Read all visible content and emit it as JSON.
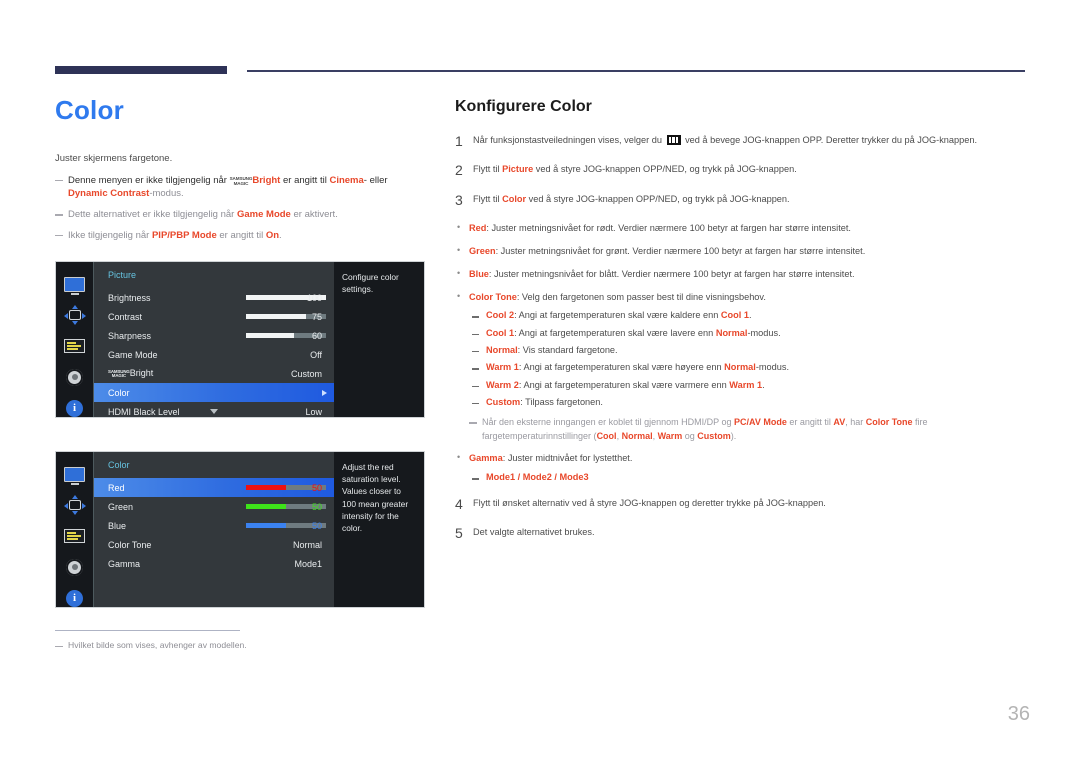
{
  "page": {
    "number": "36"
  },
  "left": {
    "title": "Color",
    "intro": "Juster skjermens fargetone.",
    "notes": [
      {
        "pre": "Denne menyen er ikke tilgjengelig når ",
        "magic_top": "SAMSUNG",
        "magic_bottom": "MAGIC",
        "magic_word": "Bright",
        "mid": " er angitt til ",
        "b1": "Cinema",
        "mid2": "- eller ",
        "b2": "Dynamic Contrast",
        "post": "-modus."
      },
      {
        "pre": "Dette alternativet er ikke tilgjengelig når ",
        "b1": "Game Mode",
        "post": " er aktivert."
      },
      {
        "pre": "Ikke tilgjengelig når ",
        "b1": "PIP/PBP Mode",
        "mid": " er angitt til ",
        "b2": "On",
        "post": "."
      }
    ],
    "footnote": "Hvilket bilde som vises, avhenger av modellen."
  },
  "osd1": {
    "title": "Picture",
    "description": "Configure color settings.",
    "rows": [
      {
        "label": "Brightness",
        "value": "100",
        "slider": 100,
        "type": "slider"
      },
      {
        "label": "Contrast",
        "value": "75",
        "slider": 75,
        "type": "slider"
      },
      {
        "label": "Sharpness",
        "value": "60",
        "slider": 60,
        "type": "slider"
      },
      {
        "label": "Game Mode",
        "value": "Off",
        "type": "value"
      },
      {
        "label": "Bright",
        "magic_top": "SAMSUNG",
        "magic_bottom": "MAGIC",
        "value": "Custom",
        "type": "magic"
      },
      {
        "label": "Color",
        "value": "",
        "type": "selected"
      },
      {
        "label": "HDMI Black Level",
        "value": "Low",
        "type": "value"
      }
    ],
    "icons": [
      "monitor-icon",
      "pip-icon",
      "osd-icon",
      "gear-icon",
      "info-icon"
    ]
  },
  "osd2": {
    "title": "Color",
    "description": "Adjust the red saturation level. Values closer to 100 mean greater intensity for the color.",
    "rows": [
      {
        "label": "Red",
        "value": "50",
        "slider": 50,
        "type": "slider-selected",
        "color": "#ee1111"
      },
      {
        "label": "Green",
        "value": "50",
        "slider": 50,
        "type": "slider",
        "color": "#3ee31a"
      },
      {
        "label": "Blue",
        "value": "50",
        "slider": 50,
        "type": "slider",
        "color": "#3b82f0"
      },
      {
        "label": "Color Tone",
        "value": "Normal",
        "type": "value"
      },
      {
        "label": "Gamma",
        "value": "Mode1",
        "type": "value"
      }
    ],
    "icons": [
      "monitor-icon",
      "pip-icon",
      "osd-icon",
      "gear-icon",
      "info-icon"
    ]
  },
  "right": {
    "title": "Konfigurere Color",
    "step1": {
      "num": "1",
      "pre": "Når funksjonstastveiledningen vises, velger du ",
      "post": " ved å bevege JOG-knappen OPP. Deretter trykker du på JOG-knappen."
    },
    "step2": {
      "num": "2",
      "pre": "Flytt til ",
      "bold": "Picture",
      "post": " ved å styre JOG-knappen OPP/NED, og trykk på JOG-knappen."
    },
    "step3": {
      "num": "3",
      "pre": "Flytt til ",
      "bold": "Color",
      "post": " ved å styre JOG-knappen OPP/NED, og trykk på JOG-knappen."
    },
    "step4": {
      "num": "4",
      "text": "Flytt til ønsket alternativ ved å styre JOG-knappen og deretter trykke på JOG-knappen."
    },
    "step5": {
      "num": "5",
      "text": "Det valgte alternativet brukes."
    },
    "bullets": {
      "red": {
        "bold": "Red",
        "text": ": Juster metningsnivået for rødt. Verdier nærmere 100 betyr at fargen har større intensitet."
      },
      "green": {
        "bold": "Green",
        "text": ": Juster metningsnivået for grønt. Verdier nærmere 100 betyr at fargen har større intensitet."
      },
      "blue": {
        "bold": "Blue",
        "text": ": Juster metningsnivået for blått. Verdier nærmere 100 betyr at fargen har større intensitet."
      },
      "colortone": {
        "bold": "Color Tone",
        "text": ": Velg den fargetonen som passer best til dine visningsbehov."
      },
      "gamma": {
        "bold": "Gamma",
        "text": ": Juster midtnivået for lystetthet."
      }
    },
    "tone_subs": [
      {
        "bold": "Cool 2",
        "pre": ": Angi at fargetemperaturen skal være kaldere enn ",
        "bold2": "Cool 1",
        "post": "."
      },
      {
        "bold": "Cool 1",
        "pre": ": Angi at fargetemperaturen skal være lavere enn ",
        "bold2": "Normal",
        "post": "-modus."
      },
      {
        "bold": "Normal",
        "pre": ": Vis standard fargetone.",
        "bold2": "",
        "post": ""
      },
      {
        "bold": "Warm 1",
        "pre": ": Angi at fargetemperaturen skal være høyere enn ",
        "bold2": "Normal",
        "post": "-modus."
      },
      {
        "bold": "Warm 2",
        "pre": ": Angi at fargetemperaturen skal være varmere enn ",
        "bold2": "Warm 1",
        "post": "."
      },
      {
        "bold": "Custom",
        "pre": ": Tilpass fargetonen.",
        "bold2": "",
        "post": ""
      }
    ],
    "tone_note": {
      "p1": "Når den eksterne inngangen er koblet til gjennom HDMI/DP og ",
      "b1": "PC/AV Mode",
      "p2": " er angitt til ",
      "b2": "AV",
      "p3": ", har ",
      "b3": "Color Tone",
      "p4": " fire fargetemperaturinnstillinger (",
      "b4": "Cool",
      "p5": ", ",
      "b5": "Normal",
      "p6": ", ",
      "b6": "Warm",
      "p7": " og ",
      "b7": "Custom",
      "p8": ")."
    },
    "gamma_modes": "Mode1 / Mode2 / Mode3"
  }
}
